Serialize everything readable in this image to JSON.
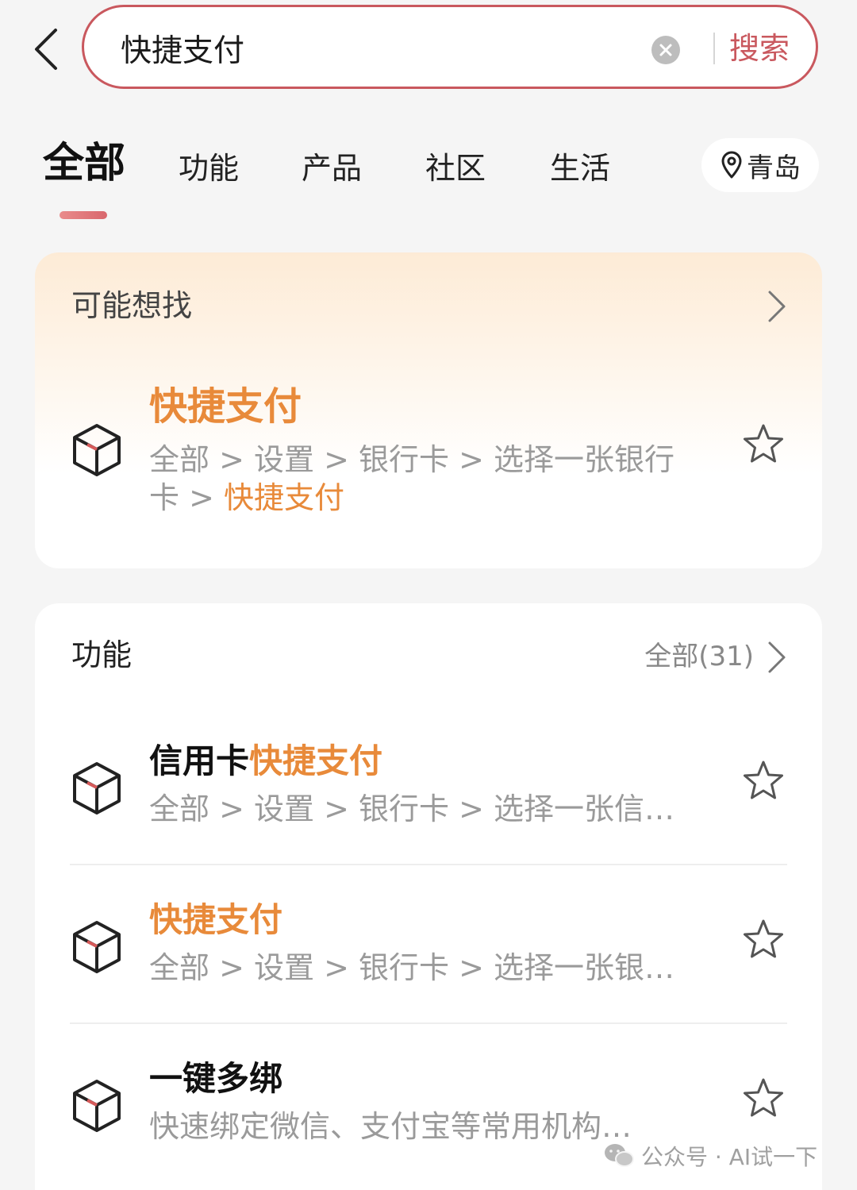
{
  "search": {
    "value": "快捷支付",
    "button_label": "搜索"
  },
  "tabs": [
    {
      "label": "全部",
      "active": true
    },
    {
      "label": "功能"
    },
    {
      "label": "产品"
    },
    {
      "label": "社区"
    },
    {
      "label": "生活"
    }
  ],
  "location": {
    "city": "青岛"
  },
  "maybe_card": {
    "header": "可能想找",
    "item": {
      "title": "快捷支付",
      "path_line1": "全部 > 设置 > 银行卡 > 选择一张银行",
      "path_line2_prefix": "卡 > ",
      "path_line2_highlight": "快捷支付"
    }
  },
  "func_card": {
    "header": "功能",
    "view_all": "全部(31)",
    "items": [
      {
        "title_plain": "信用卡",
        "title_highlight": "快捷支付",
        "path": "全部 > 设置 > 银行卡 > 选择一张信…"
      },
      {
        "title_plain": "",
        "title_highlight": "快捷支付",
        "path": "全部 > 设置 > 银行卡 > 选择一张银…"
      },
      {
        "title_plain": "一键多绑",
        "title_highlight": "",
        "path": "快速绑定微信、支付宝等常用机构…"
      }
    ]
  },
  "watermark": {
    "text": "公众号 · AI试一下"
  },
  "colors": {
    "accent": "#c9585e",
    "highlight": "#e88a3a",
    "muted": "#9a9a9a"
  }
}
